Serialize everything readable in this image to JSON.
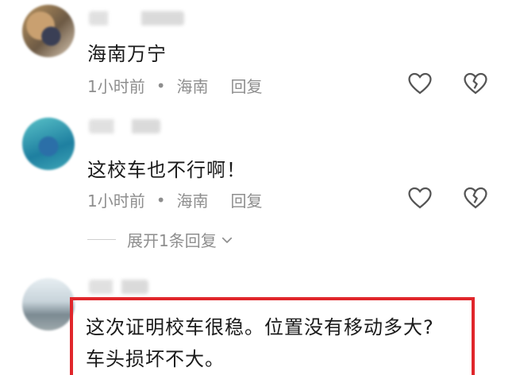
{
  "comments": [
    {
      "text": "海南万宁",
      "time": "1小时前",
      "separator": "•",
      "location": "海南",
      "reply_label": "回复"
    },
    {
      "text": "这校车也不行啊！",
      "time": "1小时前",
      "separator": "•",
      "location": "海南",
      "reply_label": "回复",
      "expand_label": "展开1条回复"
    },
    {
      "lines": [
        "这次证明校车很稳。位置没有移动多大?",
        "车头损坏不大。"
      ]
    }
  ],
  "colors": {
    "highlight": "#e0262b",
    "meta": "#8e8e8e"
  },
  "icons": [
    "heart-icon",
    "broken-heart-icon",
    "chevron-down-icon"
  ]
}
